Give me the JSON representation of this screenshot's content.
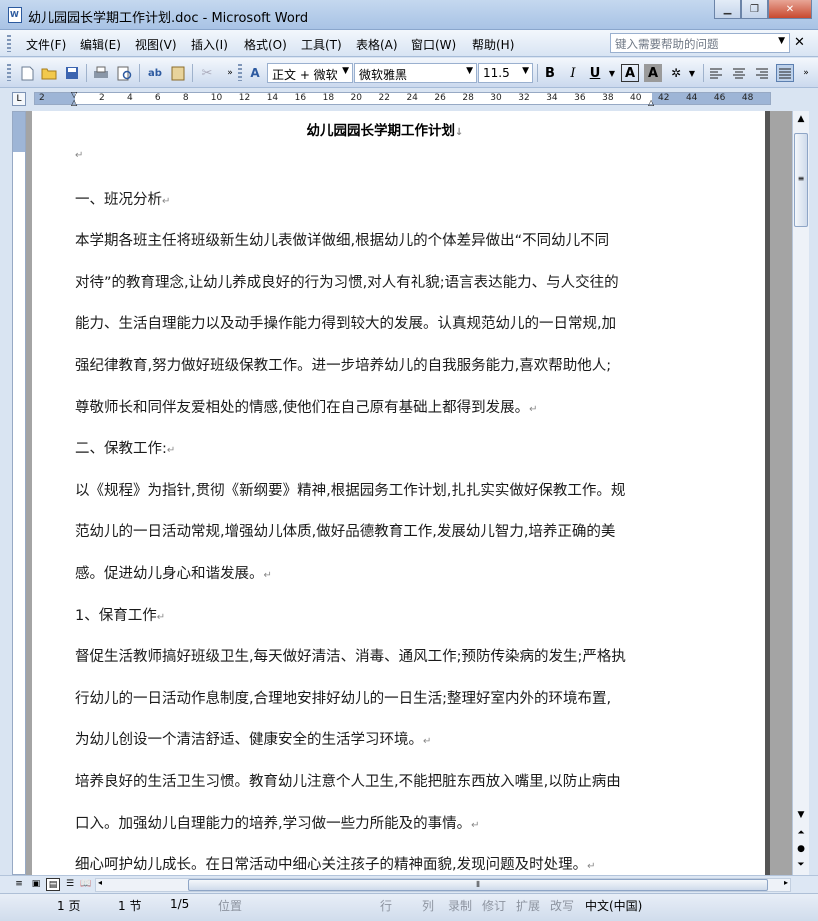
{
  "window": {
    "title": "幼儿园园长学期工作计划.doc - Microsoft Word",
    "app_icon_letter": "W",
    "min_glyph": "▁",
    "restore_glyph": "❐",
    "close_glyph": "✕"
  },
  "menu": {
    "items": [
      "文件(F)",
      "编辑(E)",
      "视图(V)",
      "插入(I)",
      "格式(O)",
      "工具(T)",
      "表格(A)",
      "窗口(W)",
      "帮助(H)"
    ],
    "help_placeholder": "键入需要帮助的问题",
    "close_glyph": "✕"
  },
  "toolbar": {
    "style_value": "正文 + 微软",
    "font_value": "微软雅黑",
    "size_value": "11.5",
    "bold": "B",
    "italic": "I",
    "underline": "U",
    "char_border": "A",
    "char_shading": "A"
  },
  "ruler": {
    "tab_selector": "L",
    "labels": [
      "2",
      "2",
      "4",
      "6",
      "8",
      "10",
      "12",
      "14",
      "16",
      "18",
      "20",
      "22",
      "24",
      "26",
      "28",
      "30",
      "32",
      "34",
      "36",
      "38",
      "40",
      "42",
      "44",
      "46",
      "48"
    ]
  },
  "document": {
    "title": "幼儿园园长学期工作计划",
    "lines": [
      "",
      "一、班况分析",
      "本学期各班主任将班级新生幼儿表做详做细,根据幼儿的个体差异做出“不同幼儿不同",
      "对待”的教育理念,让幼儿养成良好的行为习惯,对人有礼貌;语言表达能力、与人交往的",
      "能力、生活自理能力以及动手操作能力得到较大的发展。认真规范幼儿的一日常规,加",
      "强纪律教育,努力做好班级保教工作。进一步培养幼儿的自我服务能力,喜欢帮助他人;",
      "尊敬师长和同伴友爱相处的情感,使他们在自己原有基础上都得到发展。",
      "二、保教工作:",
      "以《规程》为指针,贯彻《新纲要》精神,根据园务工作计划,扎扎实实做好保教工作。规",
      "范幼儿的一日活动常规,增强幼儿体质,做好品德教育工作,发展幼儿智力,培养正确的美",
      "感。促进幼儿身心和谐发展。",
      "1、保育工作",
      "督促生活教师搞好班级卫生,每天做好清洁、消毒、通风工作;预防传染病的发生;严格执",
      "行幼儿的一日活动作息制度,合理地安排好幼儿的一日生活;整理好室内外的环境布置,",
      "为幼儿创设一个清洁舒适、健康安全的生活学习环境。",
      "培养良好的生活卫生习惯。教育幼儿注意个人卫生,不能把脏东西放入嘴里,以防止病由",
      "口入。加强幼儿自理能力的培养,学习做一些力所能及的事情。",
      "细心呵护幼儿成长。在日常活动中细心关注孩子的精神面貌,发现问题及时处理。"
    ],
    "paragraph_mark": "↵"
  },
  "status": {
    "page": "1 页",
    "section": "1 节",
    "page_of": "1/5",
    "position": "位置",
    "line": "行",
    "column": "列",
    "rec": "录制",
    "trk": "修订",
    "ext": "扩展",
    "ovr": "改写",
    "language": "中文(中国)"
  }
}
